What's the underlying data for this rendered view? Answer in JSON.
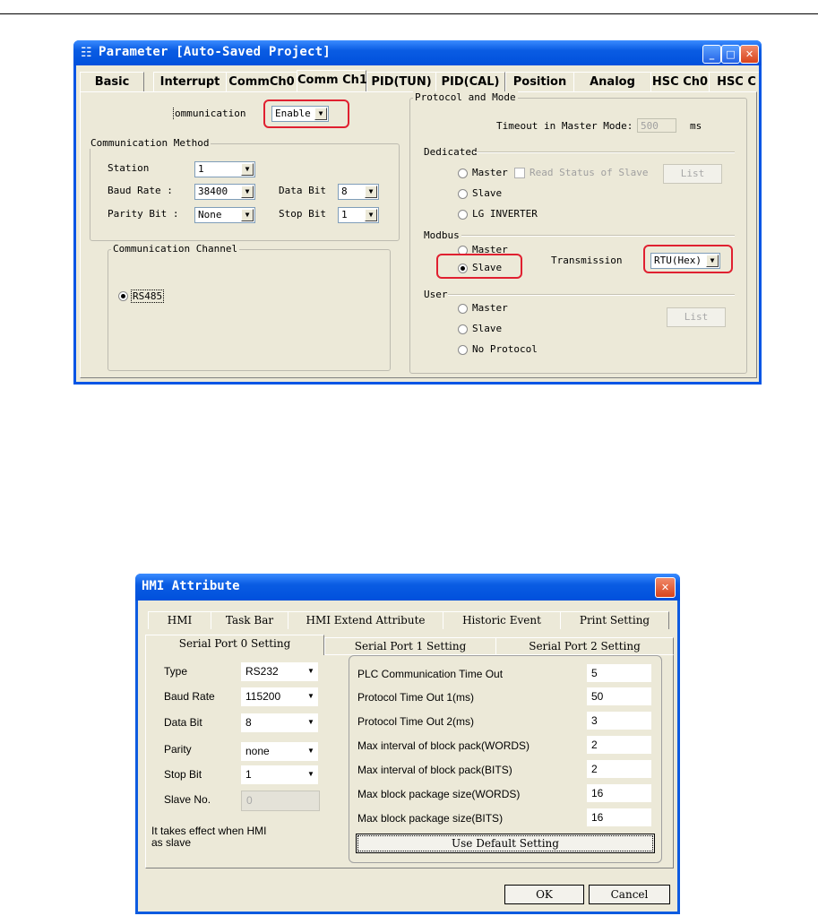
{
  "window1": {
    "title": "Parameter [Auto-Saved Project]",
    "tabs": [
      "Basic",
      "Interrupt",
      "CommCh0",
      "Comm Ch1",
      "PID(TUN)",
      "PID(CAL)",
      "Position",
      "Analog",
      "HSC Ch0",
      "HSC C"
    ],
    "active_tab": "Comm Ch1",
    "communication": {
      "label": "ommunication",
      "value": "Enable"
    },
    "method": {
      "title": "Communication Method",
      "station_label": "Station",
      "station_value": "1",
      "baud_label": "Baud Rate :",
      "baud_value": "38400",
      "databit_label": "Data Bit",
      "databit_value": "8",
      "parity_label": "Parity Bit :",
      "parity_value": "None",
      "stopbit_label": "Stop Bit",
      "stopbit_value": "1"
    },
    "channel": {
      "title": "Communication Channel",
      "option": "RS485"
    },
    "protocol": {
      "title": "Protocol and Mode",
      "timeout_label": "Timeout in Master Mode:",
      "timeout_value": "500",
      "timeout_unit": "ms",
      "dedicated_title": "Dedicated",
      "ded_master": "Master",
      "ded_read_status": "Read Status of Slave",
      "ded_list": "List",
      "ded_slave": "Slave",
      "ded_lg": "LG INVERTER",
      "modbus_title": "Modbus",
      "mb_master": "Master",
      "mb_slave": "Slave",
      "transmission_label": "Transmission",
      "transmission_value": "RTU(Hex)",
      "user_title": "User",
      "user_master": "Master",
      "user_slave": "Slave",
      "user_noproto": "No Protocol",
      "user_list": "List"
    }
  },
  "window2": {
    "title": "HMI Attribute",
    "tabs_back": [
      "HMI",
      "Task Bar",
      "HMI Extend Attribute",
      "Historic Event",
      "Print Setting"
    ],
    "tabs_front": [
      "Serial Port 0 Setting",
      "Serial Port 1 Setting",
      "Serial Port 2 Setting"
    ],
    "left": {
      "type_label": "Type",
      "type_value": "RS232",
      "baud_label": "Baud Rate",
      "baud_value": "115200",
      "databit_label": "Data Bit",
      "databit_value": "8",
      "parity_label": "Parity",
      "parity_value": "none",
      "stopbit_label": "Stop Bit",
      "stopbit_value": "1",
      "slave_label": "Slave No.",
      "slave_value": "0",
      "note": "It takes effect when HMI as slave"
    },
    "right": {
      "rows": [
        {
          "label": "PLC Communication Time Out",
          "value": "5"
        },
        {
          "label": "Protocol Time Out 1(ms)",
          "value": "50"
        },
        {
          "label": "Protocol Time Out 2(ms)",
          "value": "3"
        },
        {
          "label": "Max interval of block pack(WORDS)",
          "value": "2"
        },
        {
          "label": "Max interval of block pack(BITS)",
          "value": "2"
        },
        {
          "label": "Max block package size(WORDS)",
          "value": "16"
        },
        {
          "label": "Max block package size(BITS)",
          "value": "16"
        }
      ],
      "default_button": "Use Default Setting"
    },
    "ok": "OK",
    "cancel": "Cancel"
  }
}
